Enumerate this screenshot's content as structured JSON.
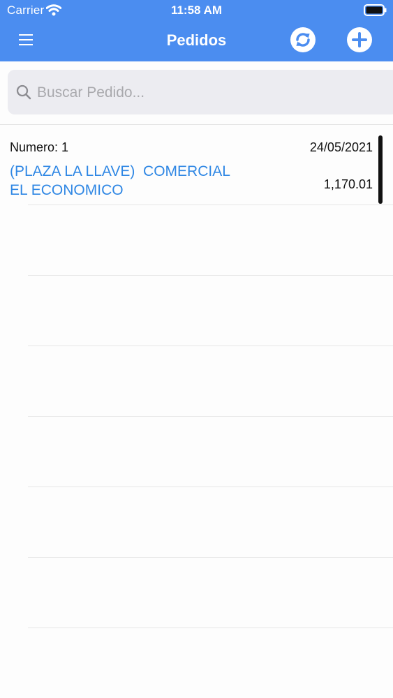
{
  "status_bar": {
    "carrier": "Carrier",
    "time": "11:58 AM"
  },
  "nav": {
    "title": "Pedidos",
    "menu_icon": "hamburger-menu-icon",
    "refresh_icon": "refresh-icon",
    "add_icon": "plus-icon"
  },
  "search": {
    "placeholder": "Buscar Pedido...",
    "value": ""
  },
  "orders": [
    {
      "number": "Numero: 1",
      "date": "24/05/2021",
      "client": "(PLAZA LA LLAVE)  COMERCIAL\nEL ECONOMICO",
      "total": "1,170.01"
    }
  ],
  "colors": {
    "header_background": "#4b8df0",
    "client_link": "#2f87e4",
    "search_background": "#ececf1"
  }
}
